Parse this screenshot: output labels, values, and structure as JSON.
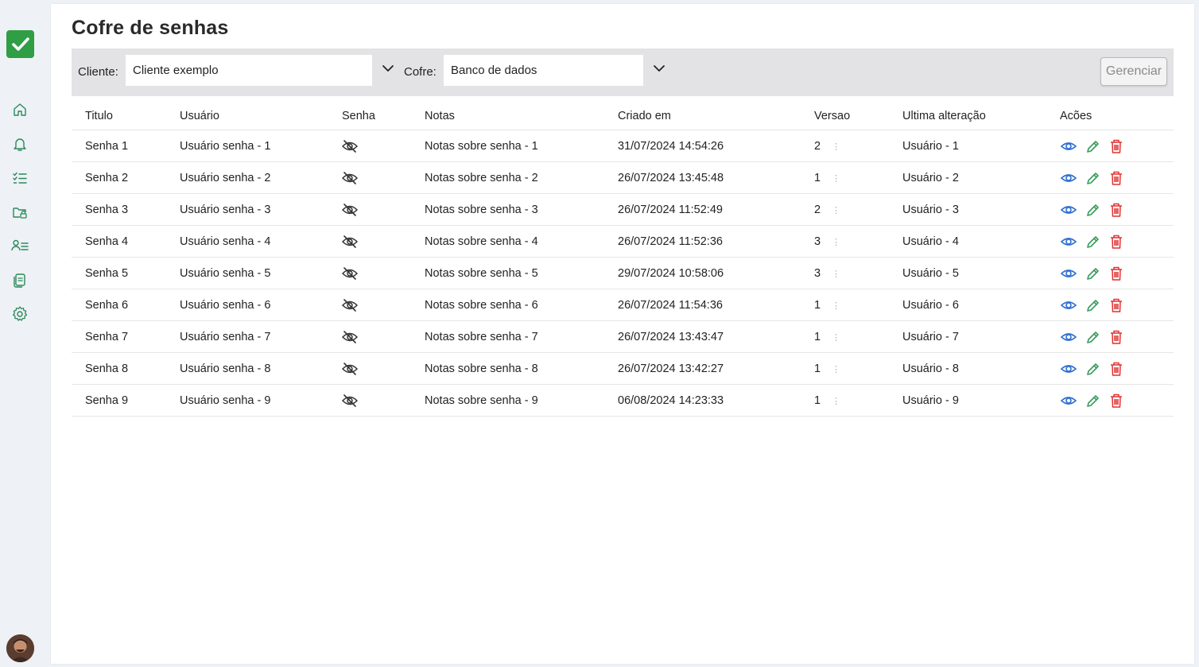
{
  "page": {
    "title": "Cofre de senhas"
  },
  "filters": {
    "client_label": "Cliente:",
    "client_value": "Cliente exemplo",
    "vault_label": "Cofre:",
    "vault_value": "Banco de dados",
    "manage_label": "Gerenciar"
  },
  "sidebar": {
    "icons": [
      "home-icon",
      "bell-icon",
      "checklist-icon",
      "folder-lock-icon",
      "user-list-icon",
      "documents-icon",
      "gear-icon"
    ]
  },
  "table": {
    "headers": [
      "Titulo",
      "Usuário",
      "Senha",
      "Notas",
      "Criado em",
      "Versao",
      "Ultima alteração",
      "Acões"
    ],
    "rows": [
      {
        "title": "Senha 1",
        "user": "Usuário senha - 1",
        "notes": "Notas sobre senha - 1",
        "created": "31/07/2024 14:54:26",
        "version": "2",
        "last_change": "Usuário - 1"
      },
      {
        "title": "Senha 2",
        "user": "Usuário senha - 2",
        "notes": "Notas sobre senha - 2",
        "created": "26/07/2024 13:45:48",
        "version": "1",
        "last_change": "Usuário - 2"
      },
      {
        "title": "Senha 3",
        "user": "Usuário senha - 3",
        "notes": "Notas sobre senha - 3",
        "created": "26/07/2024 11:52:49",
        "version": "2",
        "last_change": "Usuário - 3"
      },
      {
        "title": "Senha 4",
        "user": "Usuário senha - 4",
        "notes": "Notas sobre senha - 4",
        "created": "26/07/2024 11:52:36",
        "version": "3",
        "last_change": "Usuário - 4"
      },
      {
        "title": "Senha 5",
        "user": "Usuário senha - 5",
        "notes": "Notas sobre senha - 5",
        "created": "29/07/2024 10:58:06",
        "version": "3",
        "last_change": "Usuário - 5"
      },
      {
        "title": "Senha 6",
        "user": "Usuário senha - 6",
        "notes": "Notas sobre senha - 6",
        "created": "26/07/2024 11:54:36",
        "version": "1",
        "last_change": "Usuário - 6"
      },
      {
        "title": "Senha 7",
        "user": "Usuário senha - 7",
        "notes": "Notas sobre senha - 7",
        "created": "26/07/2024 13:43:47",
        "version": "1",
        "last_change": "Usuário - 7"
      },
      {
        "title": "Senha 8",
        "user": "Usuário senha - 8",
        "notes": "Notas sobre senha - 8",
        "created": "26/07/2024 13:42:27",
        "version": "1",
        "last_change": "Usuário - 8"
      },
      {
        "title": "Senha 9",
        "user": "Usuário senha - 9",
        "notes": "Notas sobre senha - 9",
        "created": "06/08/2024 14:23:33",
        "version": "1",
        "last_change": "Usuário - 9"
      }
    ]
  },
  "colors": {
    "brand": "#2f9e44",
    "view": "#2f6fd1",
    "edit": "#3a9a5b",
    "delete": "#e03131"
  }
}
